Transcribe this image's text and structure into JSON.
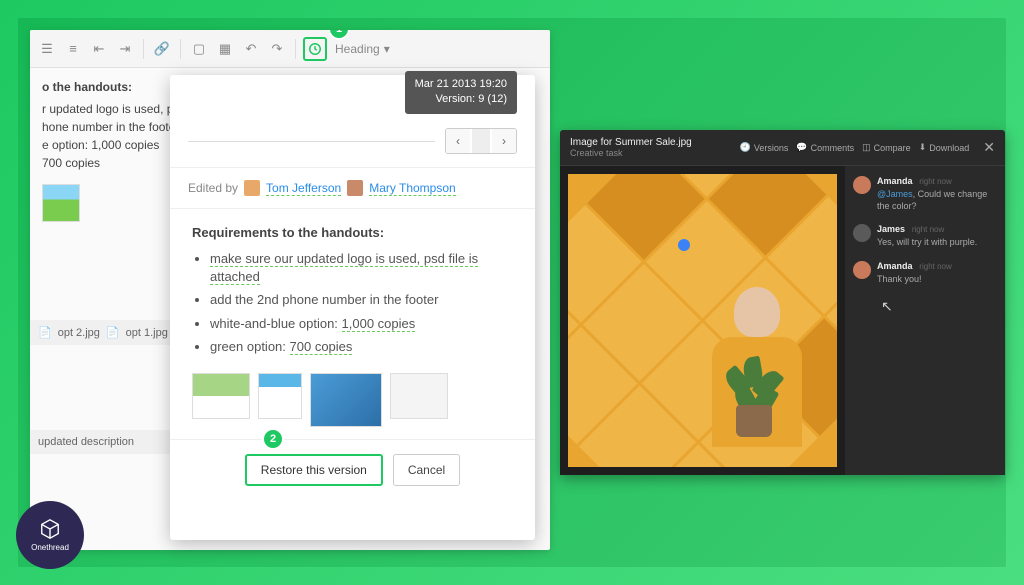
{
  "editor": {
    "toolbar": {
      "heading_label": "Heading"
    },
    "bg_doc": {
      "heading": "o the handouts:",
      "lines": [
        "r updated logo is used, p",
        "hone number in the foote",
        "e option: 1,000 copies",
        "700 copies"
      ]
    },
    "files": {
      "file1": "opt 2.jpg",
      "file2": "opt 1.jpg",
      "updated": "updated description"
    },
    "markers": {
      "m1": "1",
      "m2": "2"
    }
  },
  "version_popup": {
    "tooltip_date": "Mar 21 2013 19:20",
    "tooltip_version": "Version: 9 (12)",
    "edited_by_label": "Edited by",
    "user1": "Tom Jefferson",
    "user2": "Mary Thompson",
    "requirements_heading": "Requirements to the handouts:",
    "req1": "make sure our updated logo is used, psd file is attached",
    "req2": "add the 2nd phone number in the footer",
    "req3_prefix": "white-and-blue option: ",
    "req3_value": "1,000 copies",
    "req4_prefix": "green option: ",
    "req4_value": "700 copies",
    "restore_label": "Restore this version",
    "cancel_label": "Cancel"
  },
  "preview": {
    "filename": "Image for Summer Sale.jpg",
    "subtitle": "Creative task",
    "actions": {
      "versions": "Versions",
      "comments": "Comments",
      "compare": "Compare",
      "download": "Download"
    },
    "comments": [
      {
        "name": "Amanda",
        "time": "right now",
        "mention": "@James",
        "text": ", Could we change the color?"
      },
      {
        "name": "James",
        "time": "right now",
        "text": "Yes, will try it with purple."
      },
      {
        "name": "Amanda",
        "time": "right now",
        "text": "Thank you!"
      }
    ]
  },
  "badge_label": "Onethread"
}
